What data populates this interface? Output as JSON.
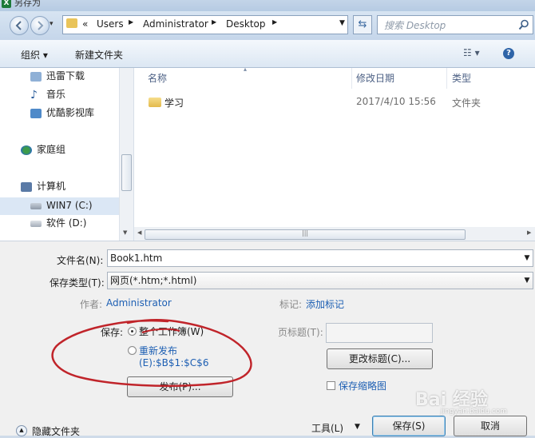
{
  "window": {
    "title": "另存为"
  },
  "address": {
    "segments": [
      "Users",
      "Administrator",
      "Desktop"
    ],
    "overflow": "«"
  },
  "search": {
    "placeholder": "搜索 Desktop"
  },
  "toolbar": {
    "organize": "组织 ▾",
    "new_folder": "新建文件夹"
  },
  "sidebar": {
    "items": [
      {
        "label": "迅雷下载",
        "icon": "download-icon"
      },
      {
        "label": "音乐",
        "icon": "music-icon"
      },
      {
        "label": "优酷影视库",
        "icon": "video-library-icon"
      },
      {
        "label": "家庭组",
        "icon": "homegroup-icon"
      },
      {
        "label": "计算机",
        "icon": "computer-icon"
      },
      {
        "label": "WIN7 (C:)",
        "icon": "drive-icon",
        "selected": true
      },
      {
        "label": "软件 (D:)",
        "icon": "drive-icon"
      }
    ]
  },
  "files": {
    "columns": [
      "名称",
      "修改日期",
      "类型"
    ],
    "rows": [
      {
        "name": "学习",
        "date": "2017/4/10 15:56",
        "type": "文件夹"
      }
    ]
  },
  "form": {
    "filename_label": "文件名(N):",
    "filename_value": "Book1.htm",
    "filetype_label": "保存类型(T):",
    "filetype_value": "网页(*.htm;*.html)",
    "author_label": "作者:",
    "author_value": "Administrator",
    "tags_label": "标记:",
    "tags_value": "添加标记",
    "save_label": "保存:",
    "radio_workbook": "整个工作簿(W)",
    "radio_republish": "重新发布",
    "republish_range": "(E):$B$1:$C$6",
    "publish_button": "发布(P)...",
    "page_title_label": "页标题(T):",
    "change_title_button": "更改标题(C)...",
    "thumbnail_label": "保存缩略图"
  },
  "footer": {
    "hide_folders": "隐藏文件夹",
    "tools": "工具(L)",
    "save": "保存(S)",
    "cancel": "取消"
  },
  "watermark": {
    "text": "Bai 经验",
    "subtext": "jingyan.baidu.com"
  },
  "colors": {
    "annotation": "#c0242a",
    "link": "#1d5fb3",
    "selection": "#dbe7f5"
  }
}
